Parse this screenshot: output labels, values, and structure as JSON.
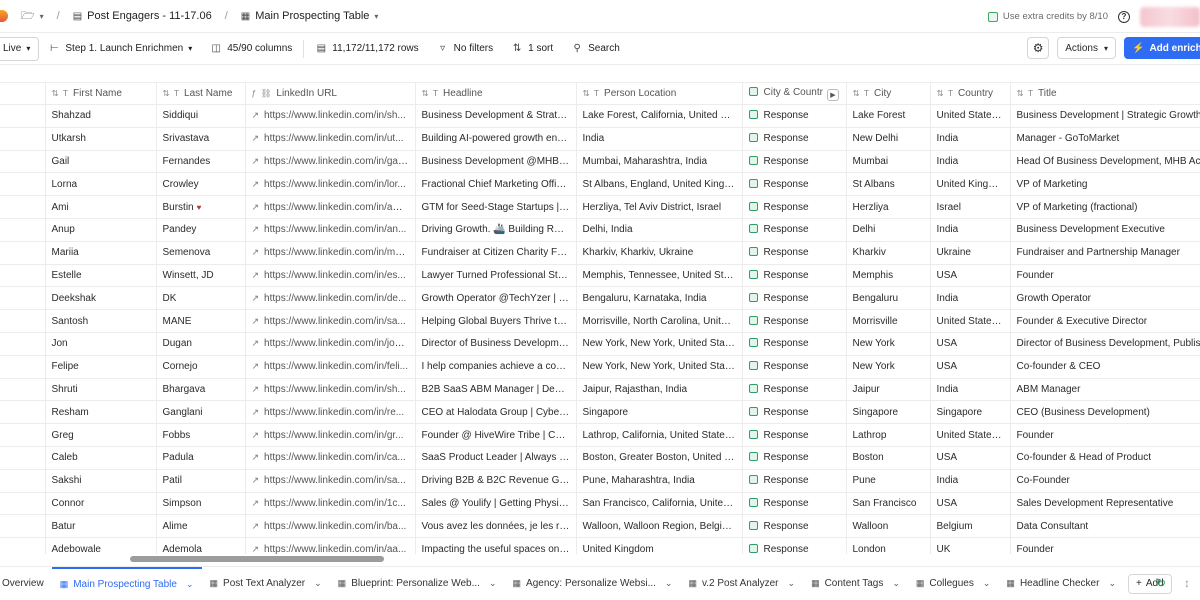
{
  "topbar": {
    "crumb1": "Post Engagers - 11-17.06",
    "crumb2": "Main Prospecting Table",
    "credits": "Use extra credits by 8/10",
    "help_glyph": "?"
  },
  "toolbar": {
    "view": "Live",
    "step": "Step 1. Launch Enrichmen",
    "columns": "45/90 columns",
    "rows": "11,172/11,172 rows",
    "filters": "No filters",
    "sort": "1 sort",
    "search": "Search",
    "actions": "Actions",
    "add_enrichment": "Add enrichm"
  },
  "columns": [
    "First Name",
    "Last Name",
    "LinkedIn URL",
    "Headline",
    "Person Location",
    "City & Countr",
    "City",
    "Country",
    "Title"
  ],
  "rows": [
    [
      "Shahzad",
      "Siddiqui",
      "https://www.linkedin.com/in/sh...",
      "Business Development & Strateg...",
      "Lake Forest, California, United Sta...",
      "Response",
      "Lake Forest",
      "United States ...",
      "Business Development | Strategic Growth &"
    ],
    [
      "Utkarsh",
      "Srivastava",
      "https://www.linkedin.com/in/ut...",
      "Building AI-powered growth engi...",
      "India",
      "Response",
      "New Delhi",
      "India",
      "Manager - GoToMarket"
    ],
    [
      "Gail",
      "Fernandes",
      "https://www.linkedin.com/in/gai...",
      "Business Development @MHB A...",
      "Mumbai, Maharashtra, India",
      "Response",
      "Mumbai",
      "India",
      "Head Of Business Development, MHB Acad"
    ],
    [
      "Lorna",
      "Crowley",
      "https://www.linkedin.com/in/lor...",
      "Fractional Chief Marketing Officer",
      "St Albans, England, United Kingdom",
      "Response",
      "St Albans",
      "United Kingdo...",
      "VP of Marketing"
    ],
    [
      "Ami",
      "Burstin",
      "https://www.linkedin.com/in/am...",
      "GTM for Seed-Stage Startups | ...",
      "Herzliya, Tel Aviv District, Israel",
      "Response",
      "Herzliya",
      "Israel",
      "VP of Marketing (fractional)"
    ],
    [
      "Anup",
      "Pandey",
      "https://www.linkedin.com/in/an...",
      "Driving Growth. 🚢 Building Rela...",
      "Delhi, India",
      "Response",
      "Delhi",
      "India",
      "Business Development Executive"
    ],
    [
      "Mariia",
      "Semenova",
      "https://www.linkedin.com/in/ma...",
      "Fundraiser at Citizen Charity Fou...",
      "Kharkiv, Kharkiv, Ukraine",
      "Response",
      "Kharkiv",
      "Ukraine",
      "Fundraiser and Partnership Manager"
    ],
    [
      "Estelle",
      "Winsett, JD",
      "https://www.linkedin.com/in/es...",
      "Lawyer Turned Professional Styli...",
      "Memphis, Tennessee, United Stat...",
      "Response",
      "Memphis",
      "USA",
      "Founder"
    ],
    [
      "Deekshak",
      "DK",
      "https://www.linkedin.com/in/de...",
      "Growth Operator @TechYzer | B...",
      "Bengaluru, Karnataka, India",
      "Response",
      "Bengaluru",
      "India",
      "Growth Operator"
    ],
    [
      "Santosh",
      "MANE",
      "https://www.linkedin.com/in/sa...",
      "Helping Global Buyers Thrive thr...",
      "Morrisville, North Carolina, United ...",
      "Response",
      "Morrisville",
      "United States ...",
      "Founder & Executive Director"
    ],
    [
      "Jon",
      "Dugan",
      "https://www.linkedin.com/in/jon...",
      "Director of Business Developme...",
      "New York, New York, United State...",
      "Response",
      "New York",
      "USA",
      "Director of Business Development, Publishe"
    ],
    [
      "Felipe",
      "Cornejo",
      "https://www.linkedin.com/in/feli...",
      "I help companies achieve a com...",
      "New York, New York, United State...",
      "Response",
      "New York",
      "USA",
      "Co-founder & CEO"
    ],
    [
      "Shruti",
      "Bhargava",
      "https://www.linkedin.com/in/sh...",
      "B2B SaaS ABM Manager | Dema...",
      "Jaipur, Rajasthan, India",
      "Response",
      "Jaipur",
      "India",
      "ABM Manager"
    ],
    [
      "Resham",
      "Ganglani",
      "https://www.linkedin.com/in/re...",
      "CEO at Halodata Group | Cyber ...",
      "Singapore",
      "Response",
      "Singapore",
      "Singapore",
      "CEO (Business Development)"
    ],
    [
      "Greg",
      "Fobbs",
      "https://www.linkedin.com/in/gr...",
      "Founder @ HiveWire Tribe | Co-F...",
      "Lathrop, California, United States ...",
      "Response",
      "Lathrop",
      "United States ...",
      "Founder"
    ],
    [
      "Caleb",
      "Padula",
      "https://www.linkedin.com/in/ca...",
      "SaaS Product Leader | Always B...",
      "Boston, Greater Boston, United St...",
      "Response",
      "Boston",
      "USA",
      "Co-founder & Head of Product"
    ],
    [
      "Sakshi",
      "Patil",
      "https://www.linkedin.com/in/sa...",
      "Driving B2B & B2C Revenue Gro...",
      "Pune, Maharashtra, India",
      "Response",
      "Pune",
      "India",
      "Co-Founder"
    ],
    [
      "Connor",
      "Simpson",
      "https://www.linkedin.com/in/1c...",
      "Sales @ Youlify | Getting Physici...",
      "San Francisco, California, United ...",
      "Response",
      "San Francisco",
      "USA",
      "Sales Development Representative"
    ],
    [
      "Batur",
      "Alime",
      "https://www.linkedin.com/in/ba...",
      "Vous avez les données, je les re...",
      "Walloon, Walloon Region, Belgium",
      "Response",
      "Walloon",
      "Belgium",
      "Data Consultant"
    ],
    [
      "Adebowale",
      "Ademola",
      "https://www.linkedin.com/in/aa...",
      "Impacting the useful spaces one...",
      "United Kingdom",
      "Response",
      "London",
      "UK",
      "Founder"
    ]
  ],
  "tabs": [
    {
      "label": "Overview"
    },
    {
      "label": "Main Prospecting Table",
      "active": true
    },
    {
      "label": "Post Text Analyzer"
    },
    {
      "label": "Blueprint: Personalize Web..."
    },
    {
      "label": "Agency: Personalize Websi..."
    },
    {
      "label": "v.2 Post Analyzer"
    },
    {
      "label": "Content Tags"
    },
    {
      "label": "Collegues"
    },
    {
      "label": "Headline Checker"
    }
  ],
  "add_tab": "Add",
  "colors": {
    "accent": "#2f6cf4",
    "response": "#2e9e66"
  }
}
